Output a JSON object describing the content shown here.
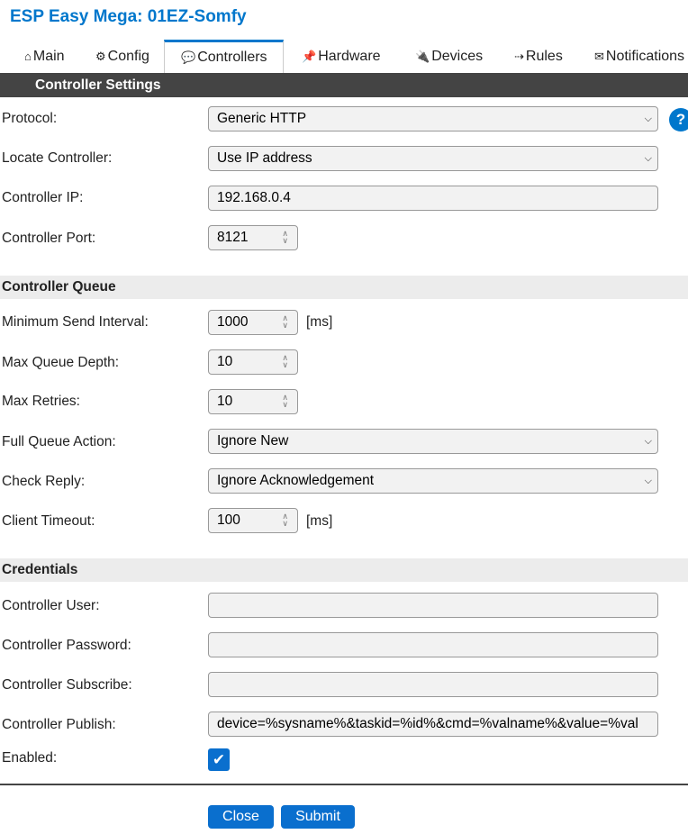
{
  "app": {
    "title": "ESP Easy Mega: 01EZ-Somfy"
  },
  "tabs": [
    {
      "icon": "⌂",
      "label": "Main"
    },
    {
      "icon": "⚙",
      "label": "Config"
    },
    {
      "icon": "💬",
      "label": "Controllers"
    },
    {
      "icon": "📌",
      "label": "Hardware"
    },
    {
      "icon": "🔌",
      "label": "Devices"
    },
    {
      "icon": "⇢",
      "label": "Rules"
    },
    {
      "icon": "✉",
      "label": "Notifications"
    }
  ],
  "header_bar": "Controller Settings",
  "settings": {
    "protocol": {
      "label": "Protocol:",
      "value": "Generic HTTP"
    },
    "locate": {
      "label": "Locate Controller:",
      "value": "Use IP address"
    },
    "ip": {
      "label": "Controller IP:",
      "value": "192.168.0.4"
    },
    "port": {
      "label": "Controller Port:",
      "value": "8121"
    }
  },
  "queue": {
    "title": "Controller Queue",
    "min_send": {
      "label": "Minimum Send Interval:",
      "value": "1000",
      "unit": "[ms]"
    },
    "max_depth": {
      "label": "Max Queue Depth:",
      "value": "10"
    },
    "max_retries": {
      "label": "Max Retries:",
      "value": "10"
    },
    "full_action": {
      "label": "Full Queue Action:",
      "value": "Ignore New"
    },
    "check_reply": {
      "label": "Check Reply:",
      "value": "Ignore Acknowledgement"
    },
    "timeout": {
      "label": "Client Timeout:",
      "value": "100",
      "unit": "[ms]"
    }
  },
  "credentials": {
    "title": "Credentials",
    "user": {
      "label": "Controller User:",
      "value": ""
    },
    "password": {
      "label": "Controller Password:",
      "value": ""
    },
    "subscribe": {
      "label": "Controller Subscribe:",
      "value": ""
    },
    "publish": {
      "label": "Controller Publish:",
      "value": "device=%sysname%&taskid=%id%&cmd=%valname%&value=%val"
    },
    "enabled": {
      "label": "Enabled:",
      "checked": true
    }
  },
  "buttons": {
    "close": "Close",
    "submit": "Submit"
  },
  "colors": {
    "accent": "#0077cc",
    "bar": "#444444",
    "button": "#0a6fce"
  }
}
